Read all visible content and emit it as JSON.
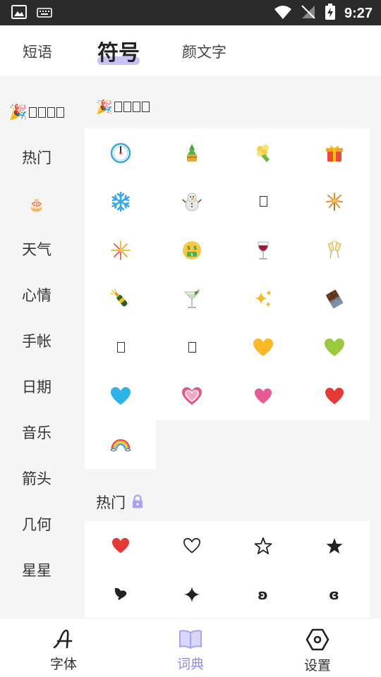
{
  "status_bar": {
    "time": "9:27"
  },
  "top_tabs": [
    {
      "label": "短语",
      "active": false
    },
    {
      "label": "符号",
      "active": true
    },
    {
      "label": "颜文字",
      "active": false
    }
  ],
  "sidebar": {
    "items": [
      {
        "label": "🎉"
      },
      {
        "label": "热门"
      },
      {
        "label": "🎂"
      },
      {
        "label": "天气"
      },
      {
        "label": "心情"
      },
      {
        "label": "手帐"
      },
      {
        "label": "日期"
      },
      {
        "label": "音乐"
      },
      {
        "label": "箭头"
      },
      {
        "label": "几何"
      },
      {
        "label": "星星"
      }
    ]
  },
  "sections": {
    "first": {
      "title": "🎉",
      "symbols": [
        "🕛",
        "🎍",
        "💐",
        "🎁",
        "❄️",
        "☃️",
        "",
        "🎇",
        "🎆",
        "🤑",
        "🍷",
        "🥂",
        "🍾",
        "🍸",
        "✨",
        "🍫",
        "",
        "",
        "💛",
        "💚",
        "💙",
        "💗",
        "💗",
        "❤️",
        "🌈"
      ]
    },
    "hot": {
      "title": "热门",
      "symbols": [
        "❤️",
        "♡",
        "☆",
        "★",
        "❥",
        "✦",
        "ʚ",
        "ɞ"
      ]
    }
  },
  "bottom_nav": [
    {
      "label": "字体",
      "active": false
    },
    {
      "label": "词典",
      "active": true
    },
    {
      "label": "设置",
      "active": false
    }
  ],
  "colors": {
    "accent": "#8f8af0",
    "highlight": "#c6c3f5",
    "background": "#f5f5f5"
  }
}
